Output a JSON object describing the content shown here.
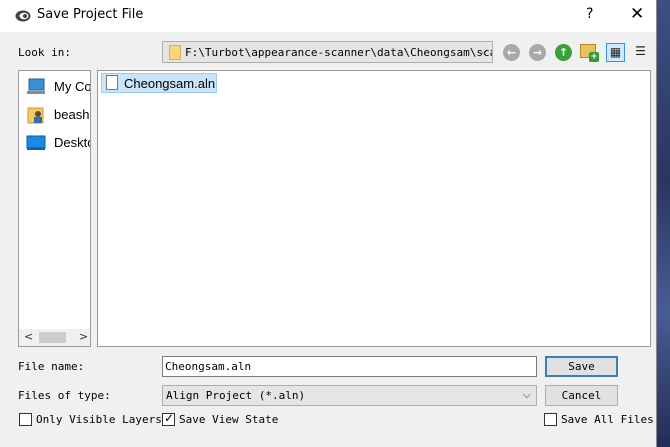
{
  "window": {
    "title": "Save Project File",
    "help": "?",
    "close": "✕"
  },
  "lookin": {
    "label": "Look in:",
    "path": "F:\\Turbot\\appearance-scanner\\data\\Cheongsam\\scan",
    "arrow": "⌵"
  },
  "toolbar": {
    "back_icon": "back-arrow-icon",
    "forward_icon": "forward-arrow-icon",
    "up_icon": "up-arrow-icon",
    "new_folder_icon": "new-folder-icon",
    "list_view_icon": "detail-list-icon",
    "detail_view_icon": "list-view-icon"
  },
  "sidebar": {
    "items": [
      {
        "label": "My Co",
        "icon": "computer-icon"
      },
      {
        "label": "beash",
        "icon": "user-folder-icon"
      },
      {
        "label": "Deskto",
        "icon": "desktop-icon"
      }
    ],
    "scroll_left": "<",
    "scroll_right": ">"
  },
  "files": [
    {
      "name": "Cheongsam.aln",
      "selected": true
    }
  ],
  "filename": {
    "label": "File name:",
    "value": "Cheongsam.aln"
  },
  "filetype": {
    "label": "Files of type:",
    "value": "Align Project (*.aln)",
    "arrow": "⌵"
  },
  "buttons": {
    "save": "Save",
    "cancel": "Cancel"
  },
  "options": {
    "only_visible_layers": {
      "label": "Only Visible Layers",
      "checked": false
    },
    "save_view_state": {
      "label": "Save View State",
      "checked": true
    },
    "save_all_files": {
      "label": "Save All Files",
      "checked": false
    }
  },
  "colors": {
    "accent": "#3c7fb1",
    "selection": "#cce4f7",
    "nav_disabled": "#a9a9a9",
    "nav_up": "#3aa03a"
  }
}
